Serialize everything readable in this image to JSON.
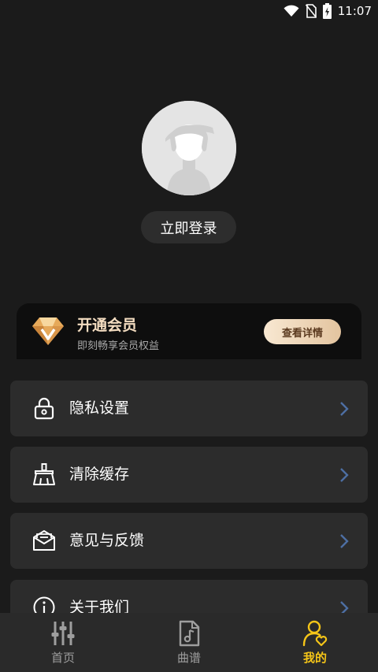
{
  "status_bar": {
    "time": "11:07",
    "icons": [
      "wifi-icon",
      "no-sim-icon",
      "battery-charging-icon"
    ]
  },
  "profile": {
    "avatar_icon": "default-avatar-icon",
    "login_label": "立即登录"
  },
  "vip": {
    "icon": "diamond-icon",
    "title": "开通会员",
    "subtitle": "即刻畅享会员权益",
    "button_label": "查看详情",
    "accent_color": "#f3dcc0"
  },
  "menu": {
    "items": [
      {
        "label": "隐私设置",
        "icon": "lock-icon"
      },
      {
        "label": "清除缓存",
        "icon": "broom-icon"
      },
      {
        "label": "意见与反馈",
        "icon": "envelope-icon"
      },
      {
        "label": "关于我们",
        "icon": "info-icon"
      }
    ]
  },
  "bottom_nav": {
    "items": [
      {
        "label": "首页",
        "icon": "sliders-icon"
      },
      {
        "label": "曲谱",
        "icon": "music-file-icon"
      },
      {
        "label": "我的",
        "icon": "user-heart-icon"
      }
    ],
    "active": "我的",
    "active_color": "#f5c518"
  }
}
